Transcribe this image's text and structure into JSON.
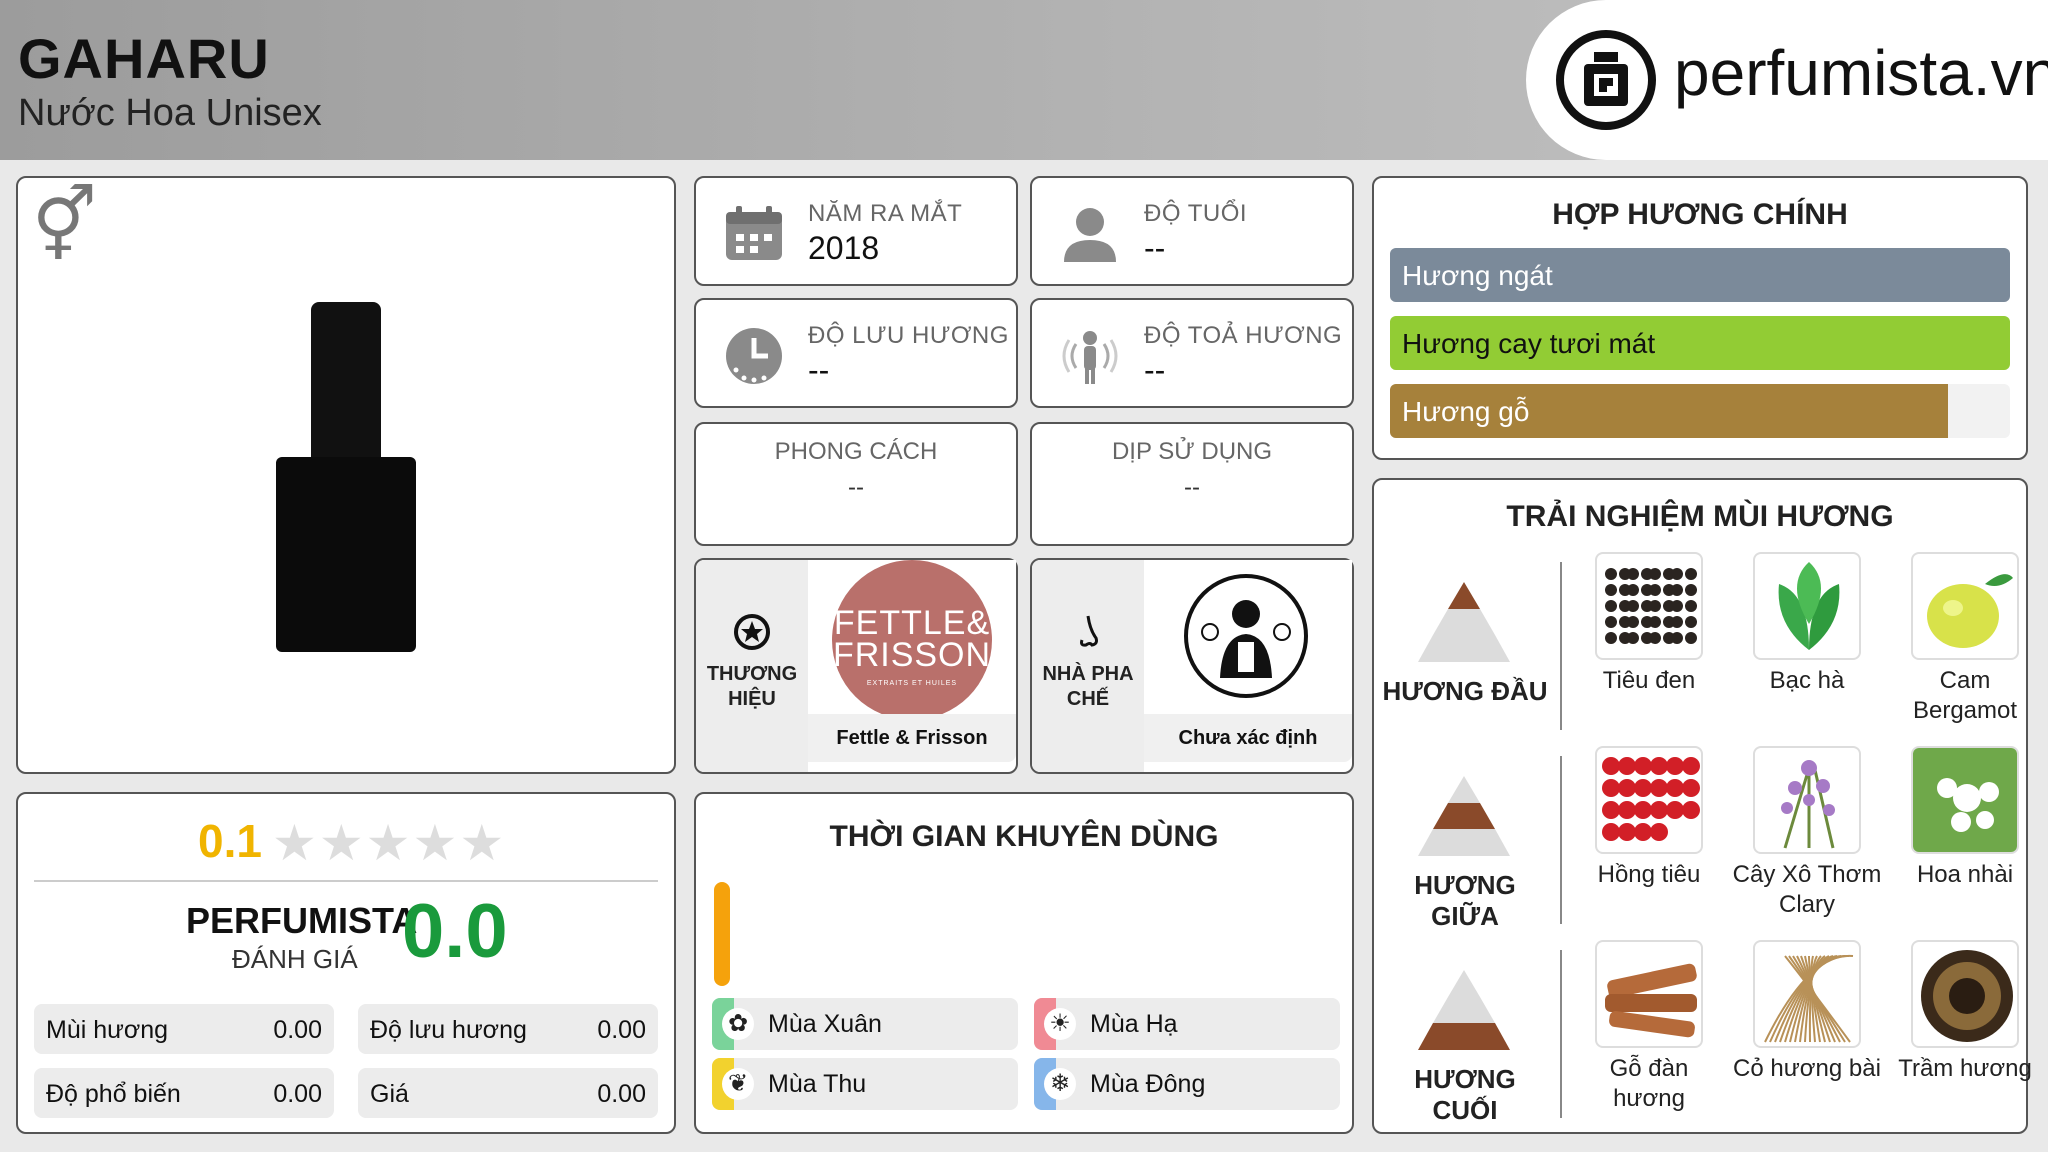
{
  "header": {
    "title": "GAHARU",
    "subtitle": "Nước Hoa Unisex",
    "logo_text": "perfumista.vn"
  },
  "info": {
    "launch_year": {
      "label": "NĂM RA MẮT",
      "value": "2018"
    },
    "age": {
      "label": "ĐỘ TUỔI",
      "value": "--"
    },
    "longevity": {
      "label": "ĐỘ LƯU HƯƠNG",
      "value": "--"
    },
    "sillage": {
      "label": "ĐỘ TOẢ HƯƠNG",
      "value": "--"
    },
    "style": {
      "label": "PHONG CÁCH",
      "value": "--"
    },
    "occasion": {
      "label": "DỊP SỬ DỤNG",
      "value": "--"
    }
  },
  "brand": {
    "label": "THƯƠNG HIỆU",
    "name": "Fettle & Frisson",
    "logo_line1": "FETTLE&",
    "logo_line2": "FRISSON",
    "logo_tagline": "EXTRAITS ET HUILES"
  },
  "perfumer": {
    "label": "NHÀ PHA CHẾ",
    "name": "Chưa xác định"
  },
  "accords": {
    "title": "HỢP HƯƠNG CHÍNH",
    "items": [
      {
        "label": "Hương ngát",
        "color": "#7b8a9a",
        "text_color": "#ffffff",
        "level": 1.0
      },
      {
        "label": "Hương cay tươi mát",
        "color": "#92cc34",
        "text_color": "#111111",
        "level": 1.0
      },
      {
        "label": "Hương gỗ",
        "color": "#a6813b",
        "text_color": "#ffffff",
        "level": 0.9
      }
    ]
  },
  "experience": {
    "title": "TRẢI NGHIỆM MÙI HƯƠNG",
    "tiers": [
      {
        "label": "HƯƠNG ĐẦU",
        "notes": [
          "Tiêu đen",
          "Bạc hà",
          "Cam Bergamot"
        ]
      },
      {
        "label": "HƯƠNG GIỮA",
        "notes": [
          "Hồng tiêu",
          "Cây Xô Thơm Clary",
          "Hoa nhài"
        ]
      },
      {
        "label": "HƯƠNG CUỐI",
        "notes": [
          "Gỗ đàn hương",
          "Cỏ hương bài",
          "Trầm hương"
        ]
      }
    ]
  },
  "rating": {
    "user_score": "0.1",
    "stars_filled": 0,
    "perfumista_label": "PERFUMISTA",
    "perfumista_sub": "ĐÁNH GIÁ",
    "perfumista_score": "0.0",
    "metrics": [
      {
        "label": "Mùi hương",
        "value": "0.00"
      },
      {
        "label": "Độ lưu hương",
        "value": "0.00"
      },
      {
        "label": "Độ phổ biến",
        "value": "0.00"
      },
      {
        "label": "Giá",
        "value": "0.00"
      }
    ]
  },
  "time": {
    "title": "THỜI GIAN KHUYÊN DÙNG",
    "seasons": [
      {
        "label": "Mùa Xuân",
        "color": "#7ad39a",
        "icon": "flower-icon"
      },
      {
        "label": "Mùa Hạ",
        "color": "#f08a94",
        "icon": "sun-icon"
      },
      {
        "label": "Mùa Thu",
        "color": "#f2d22e",
        "icon": "leaf-icon"
      },
      {
        "label": "Mùa Đông",
        "color": "#86b6ea",
        "icon": "snowflake-icon"
      }
    ]
  }
}
